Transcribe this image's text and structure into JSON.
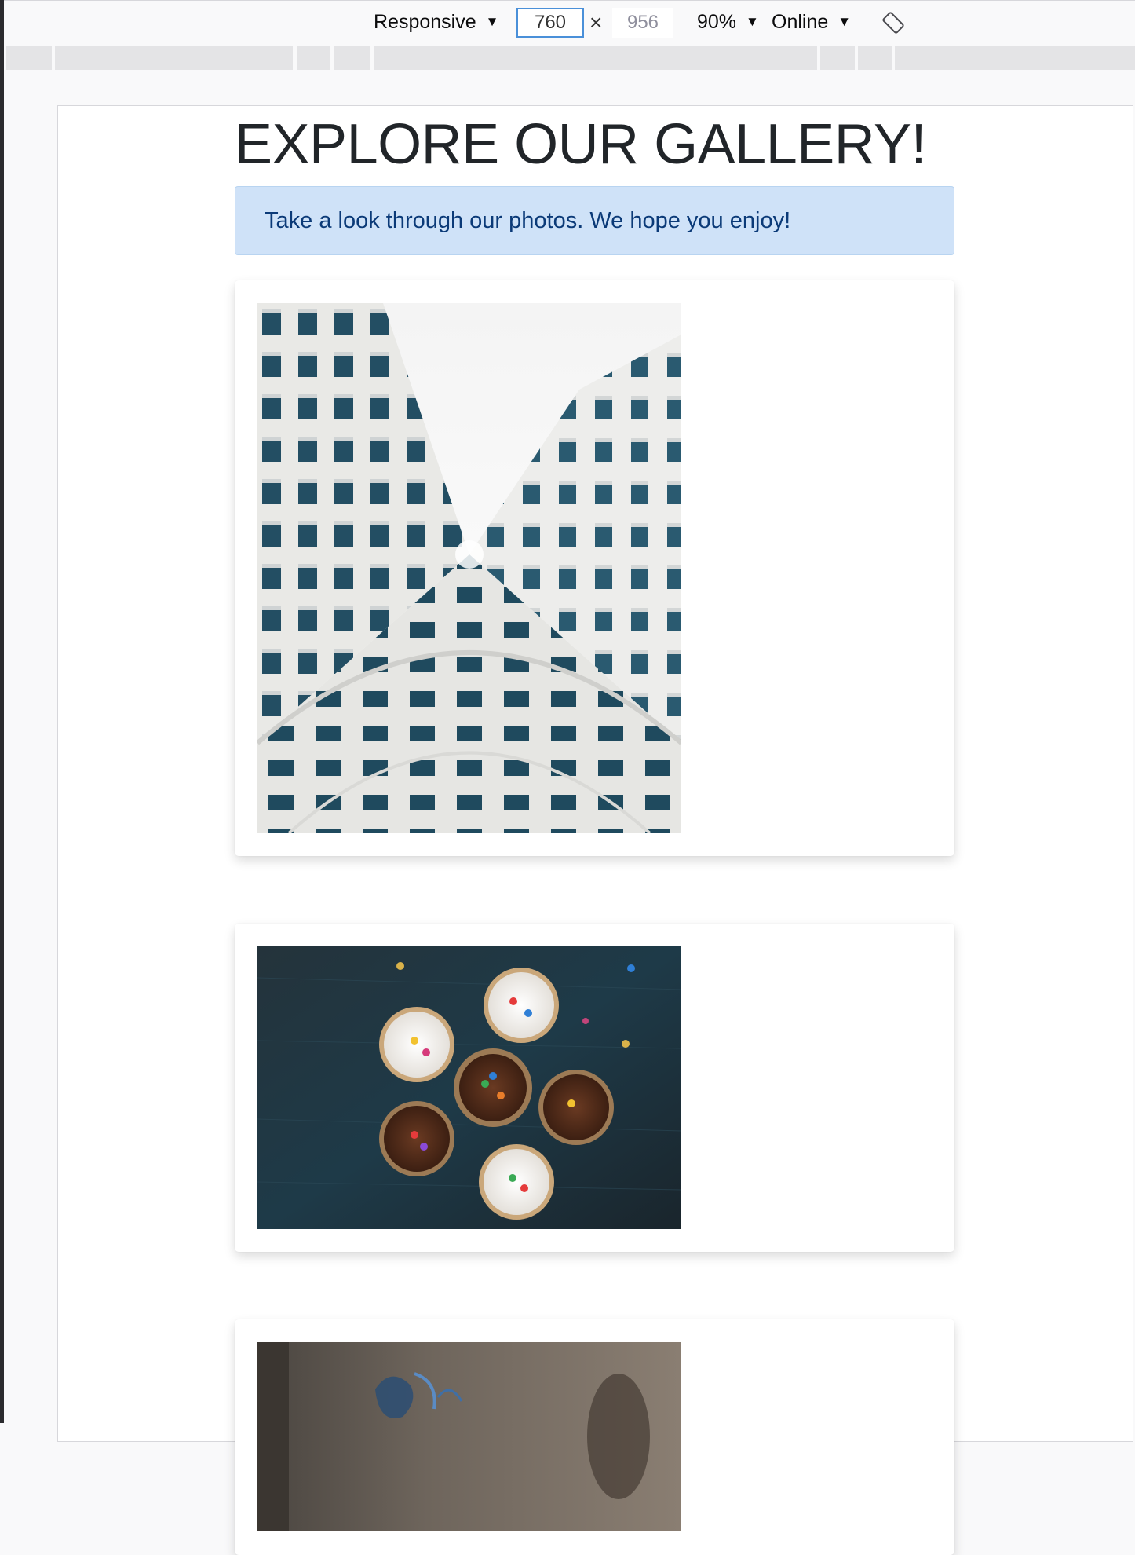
{
  "toolbar": {
    "device_label": "Responsive",
    "width_value": "760",
    "times_symbol": "×",
    "height_value": "956",
    "zoom_label": "90%",
    "network_label": "Online"
  },
  "page": {
    "title": "EXPLORE OUR GALLERY!",
    "alert_text": "Take a look through our photos. We hope you enjoy!"
  },
  "gallery": {
    "images": [
      "building-looking-up-photo",
      "cupcakes-photo",
      "street-wall-photo"
    ]
  },
  "colors": {
    "alert_bg": "#cfe2f8",
    "alert_text": "#0b3a78",
    "input_focus": "#4a90d9"
  }
}
